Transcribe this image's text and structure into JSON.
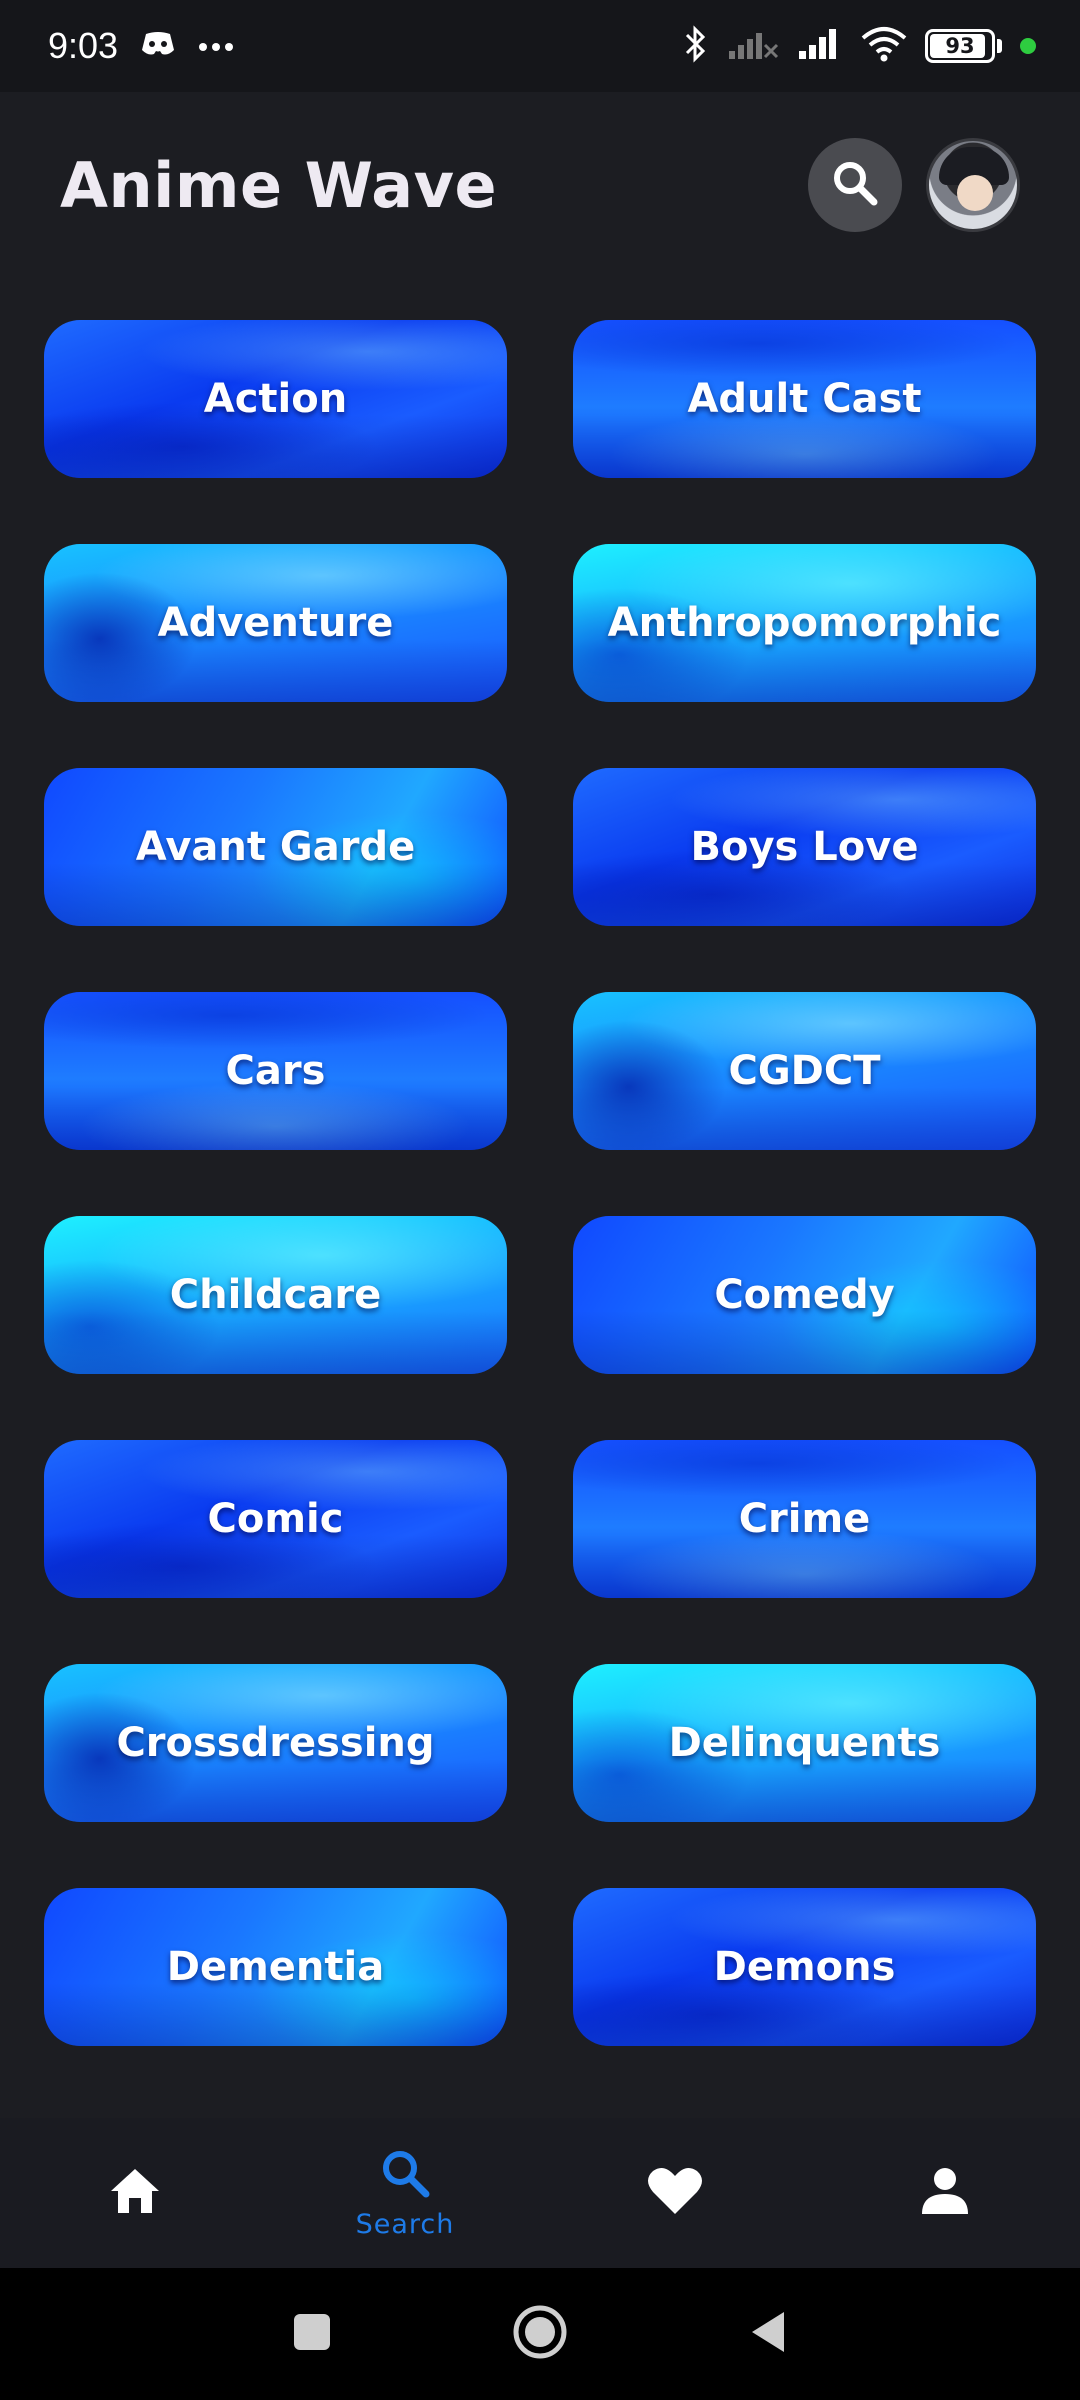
{
  "status_bar": {
    "time": "9:03",
    "battery": "93",
    "icons": [
      "discord-icon",
      "more-dots-icon",
      "bluetooth-icon",
      "no-signal-icon",
      "signal-icon",
      "wifi-icon",
      "battery-icon",
      "privacy-dot"
    ]
  },
  "header": {
    "title": "Anime Wave",
    "icons": [
      "search-icon",
      "avatar"
    ]
  },
  "genres": [
    {
      "label": "Action"
    },
    {
      "label": "Adult Cast"
    },
    {
      "label": "Adventure"
    },
    {
      "label": "Anthropomorphic"
    },
    {
      "label": "Avant Garde"
    },
    {
      "label": "Boys Love"
    },
    {
      "label": "Cars"
    },
    {
      "label": "CGDCT"
    },
    {
      "label": "Childcare"
    },
    {
      "label": "Comedy"
    },
    {
      "label": "Comic"
    },
    {
      "label": "Crime"
    },
    {
      "label": "Crossdressing"
    },
    {
      "label": "Delinquents"
    },
    {
      "label": "Dementia"
    },
    {
      "label": "Demons"
    }
  ],
  "bottom_nav": {
    "items": [
      {
        "icon": "home-icon",
        "label": ""
      },
      {
        "icon": "search-icon",
        "label": "Search",
        "active": true
      },
      {
        "icon": "heart-icon",
        "label": ""
      },
      {
        "icon": "profile-icon",
        "label": ""
      }
    ]
  },
  "system_nav": {
    "icons": [
      "recents-icon",
      "home-circle-icon",
      "back-icon"
    ]
  },
  "colors": {
    "background": "#1c1d22",
    "accent": "#1e7be8",
    "card_blue": "#1a5cff"
  }
}
